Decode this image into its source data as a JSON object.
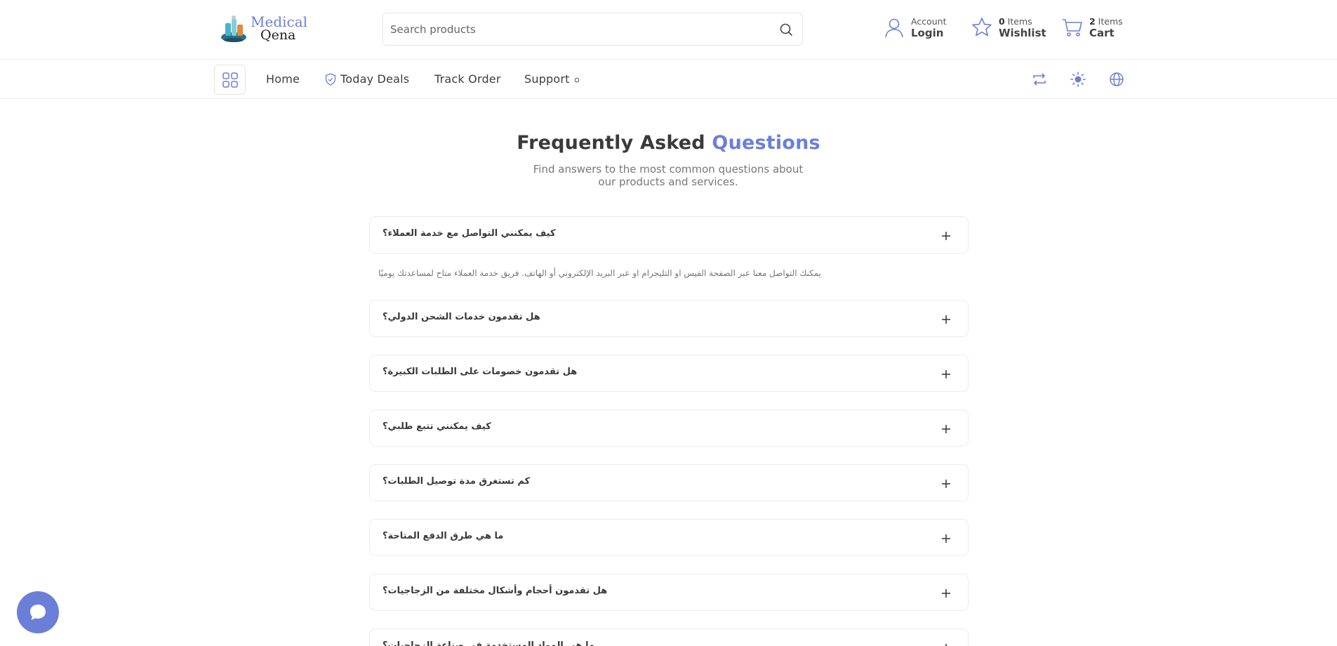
{
  "brand": {
    "line1": "Medical",
    "line2": "Qena"
  },
  "search": {
    "placeholder": "Search products"
  },
  "account": {
    "small": "Account",
    "big": "Login"
  },
  "wishlist": {
    "count": "0",
    "small_suffix": " Items",
    "big": "Wishlist"
  },
  "cart": {
    "count": "2",
    "small_suffix": " Items",
    "big": "Cart"
  },
  "nav": {
    "home": "Home",
    "today_deals": "Today Deals",
    "track_order": "Track Order",
    "support": "Support"
  },
  "page": {
    "title_main": "Frequently Asked ",
    "title_accent": "Questions",
    "subtitle": "Find answers to the most common questions about our products and services."
  },
  "faqs": [
    {
      "question": "كيف يمكنني التواصل مع خدمة العملاء؟",
      "answer": "يمكنك التواصل معنا عبر الصفحة الفيس او التليجرام او عبر البريد الإلكتروني أو الهاتف. فريق خدمة العملاء متاح لمساعدتك يوميًا"
    },
    {
      "question": "هل تقدمون خدمات الشحن الدولي؟"
    },
    {
      "question": "هل تقدمون خصومات على الطلبات الكبيرة؟"
    },
    {
      "question": "كيف يمكنني تتبع طلبي؟"
    },
    {
      "question": "كم تستغرق مدة توصيل الطلبات؟"
    },
    {
      "question": "ما هي طرق الدفع المتاحة؟"
    },
    {
      "question": "هل تقدمون أحجام وأشكال مختلفة من الزجاجيات؟"
    },
    {
      "question": "ما هي المواد المستخدمة في صناعة الزجاجيات؟"
    }
  ],
  "colors": {
    "accent": "#6c7fd8",
    "text": "#3a3a3a",
    "border": "#ececec"
  }
}
